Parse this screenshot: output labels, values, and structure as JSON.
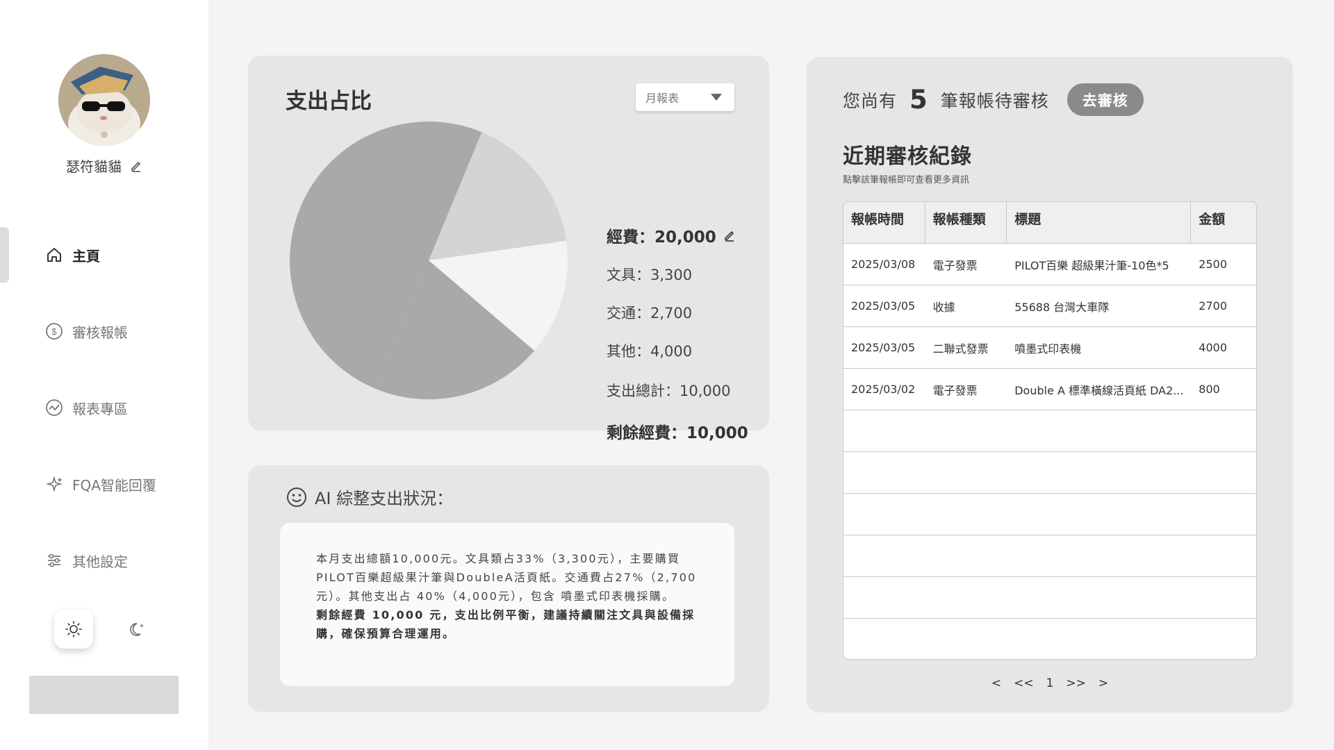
{
  "user": {
    "name": "瑟符貓貓"
  },
  "nav": [
    {
      "label": "主頁",
      "icon": "home-icon",
      "active": true
    },
    {
      "label": "審核報帳",
      "icon": "dollar-circle-icon"
    },
    {
      "label": "報表專區",
      "icon": "chart-line-icon"
    },
    {
      "label": "FQA智能回覆",
      "icon": "sparkle-icon"
    },
    {
      "label": "其他設定",
      "icon": "sliders-icon"
    }
  ],
  "theme": {
    "selected": "light",
    "options": [
      "sun-icon",
      "moon-icon"
    ]
  },
  "pie_card": {
    "title": "支出占比",
    "dropdown_value": "月報表",
    "legend": {
      "budget": "經費：20,000",
      "stationery": "文具：3,300",
      "transport": "交通：2,700",
      "other": "其他：4,000",
      "total": "支出總計：10,000",
      "remaining": "剩餘經費：10,000"
    }
  },
  "chart_data": {
    "type": "pie",
    "categories": [
      "文具",
      "交通",
      "其他",
      "剩餘經費"
    ],
    "values": [
      3300,
      2700,
      4000,
      10000
    ],
    "colors": [
      "#d4d4d4",
      "#f4f4f4",
      "#a9a9a9",
      "#a9a9a9"
    ]
  },
  "ai_card": {
    "title": "AI 綜整支出狀況：",
    "summary": "本月支出總額10,000元。文具類占33%（3,300元），主要購買PILOT百樂超級果汁筆與DoubleA活頁紙。交通費占27%（2,700 元）。其他支出占 40%（4,000元），包含 噴墨式印表機採購。",
    "advice": "剩餘經費 10,000 元，支出比例平衡，建議持續關注文具與設備採購，確保預算合理運用。"
  },
  "records": {
    "pending_prefix": "您尚有",
    "pending_count": "5",
    "pending_suffix": "筆報帳待審核",
    "review_button": "去審核",
    "title": "近期審核紀錄",
    "subtitle": "點擊該筆報帳即可查看更多資訊",
    "columns": [
      "報帳時間",
      "報帳種類",
      "標題",
      "金額"
    ],
    "rows": [
      [
        "2025/03/08",
        "電子發票",
        "PILOT百樂 超級果汁筆-10色*5",
        "2500"
      ],
      [
        "2025/03/05",
        "收據",
        "55688 台灣大車隊",
        "2700"
      ],
      [
        "2025/03/05",
        "二聯式發票",
        "噴墨式印表機",
        "4000"
      ],
      [
        "2025/03/02",
        "電子發票",
        "Double A 標準橫線活頁紙 DA2...",
        "800"
      ]
    ],
    "empty_rows": 6,
    "pager": {
      "first": "<<",
      "prev": "<",
      "page": "1",
      "next": ">",
      "last": ">>"
    }
  }
}
